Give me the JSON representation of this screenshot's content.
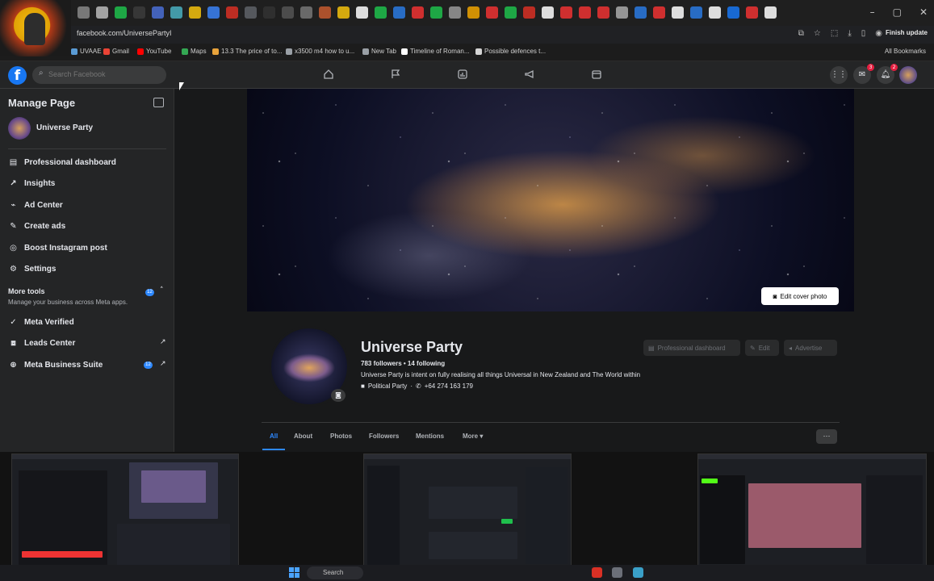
{
  "browser": {
    "url": "facebook.com/UniversePartyI",
    "finish_update": "Finish update",
    "all_bookmarks": "All Bookmarks",
    "window_controls": [
      "–",
      "▢",
      "✕"
    ],
    "bookmarks": [
      {
        "label": "UVAAE",
        "color": "#5a9bd5"
      },
      {
        "label": "Gmail",
        "color": "#ea4335"
      },
      {
        "label": "YouTube",
        "color": "#ff0000"
      },
      {
        "label": "Maps",
        "color": "#34a853"
      },
      {
        "label": "13.3 The price of to...",
        "color": "#e8a33b"
      },
      {
        "label": "x3500 m4 how to u...",
        "color": "#9aa0a6"
      },
      {
        "label": "New Tab",
        "color": "#9aa0a6"
      },
      {
        "label": "Timeline of Roman...",
        "color": "#ffffff"
      },
      {
        "label": "Possible defences t...",
        "color": "#d4d4d4"
      }
    ],
    "tab_favicon_colors": [
      "#888",
      "#bbb",
      "#1fbf4c",
      "#3c3c3c",
      "#4a6fd6",
      "#4ab0c1",
      "#f4c20d",
      "#3b82f6",
      "#d93025",
      "#5f6368",
      "#333",
      "#555",
      "#777",
      "#c65b2f",
      "#f4c20d",
      "#ffffff",
      "#1fbf4c",
      "#2a7ae2",
      "#e33",
      "#1fbf4c",
      "#999",
      "#f0a500",
      "#e33",
      "#1fbf4c",
      "#d93025",
      "#fff",
      "#e33",
      "#e33",
      "#e33",
      "#aaa",
      "#2a7ae2",
      "#e33",
      "#fff",
      "#2a7ae2",
      "#fff",
      "#1877f2",
      "#e33",
      "#fff"
    ]
  },
  "fb_nav": {
    "logo": "f",
    "search_placeholder": "Search Facebook",
    "badges": {
      "messenger": "3",
      "notifications": "2"
    }
  },
  "sidebar": {
    "title": "Manage Page",
    "page_name": "Universe Party",
    "items": [
      {
        "label": "Professional dashboard",
        "icon": "dashboard-icon"
      },
      {
        "label": "Insights",
        "icon": "insights-icon"
      },
      {
        "label": "Ad Center",
        "icon": "ad-center-icon"
      },
      {
        "label": "Create ads",
        "icon": "create-ads-icon"
      },
      {
        "label": "Boost Instagram post",
        "icon": "instagram-icon"
      },
      {
        "label": "Settings",
        "icon": "gear-icon"
      }
    ],
    "more_tools": {
      "label": "More tools",
      "count": "12",
      "subtitle": "Manage your business across Meta apps."
    },
    "tools": [
      {
        "label": "Meta Verified",
        "icon": "verified-icon",
        "count": "",
        "external": false
      },
      {
        "label": "Leads Center",
        "icon": "leads-icon",
        "count": "",
        "external": true
      },
      {
        "label": "Meta Business Suite",
        "icon": "business-suite-icon",
        "count": "12",
        "external": true
      }
    ]
  },
  "profile": {
    "edit_cover": "Edit cover photo",
    "name": "Universe Party",
    "stats": "783 followers • 14 following",
    "bio": "Universe Party is intent on fully realising all things Universal in New Zealand and The World within",
    "category": "Political Party",
    "phone": "+64 274 163 179",
    "actions": [
      "Professional dashboard",
      "Edit",
      "Advertise"
    ]
  },
  "tabs": [
    "All",
    "About",
    "Photos",
    "Followers",
    "Mentions",
    "More"
  ],
  "more_options": "···",
  "taskbar": {
    "search": "Search"
  }
}
